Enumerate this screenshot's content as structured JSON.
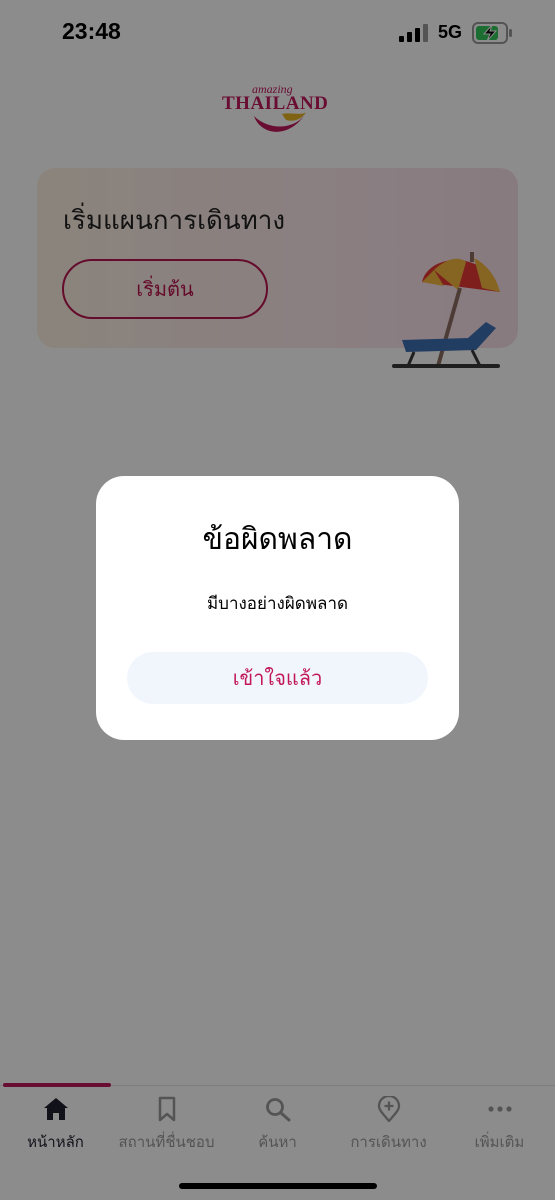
{
  "status_bar": {
    "time": "23:48",
    "network": "5G"
  },
  "logo": {
    "amazing": "amazing",
    "brand": "THAILAND"
  },
  "plan_card": {
    "title": "เริ่มแผนการเดินทาง",
    "button_label": "เริ่มต้น"
  },
  "tabs": [
    {
      "label": "หน้าหลัก",
      "icon": "home-icon",
      "active": true
    },
    {
      "label": "สถานที่ชื่นชอบ",
      "icon": "bookmark-icon",
      "active": false
    },
    {
      "label": "ค้นหา",
      "icon": "search-icon",
      "active": false
    },
    {
      "label": "การเดินทาง",
      "icon": "map-pin-plus-icon",
      "active": false
    },
    {
      "label": "เพิ่มเติม",
      "icon": "more-icon",
      "active": false
    }
  ],
  "dialog": {
    "title": "ข้อผิดพลาด",
    "message": "มีบางอย่างผิดพลาด",
    "button_label": "เข้าใจแล้ว"
  },
  "colors": {
    "accent": "#c2185b",
    "dialog_button_bg": "#f1f6fd"
  }
}
